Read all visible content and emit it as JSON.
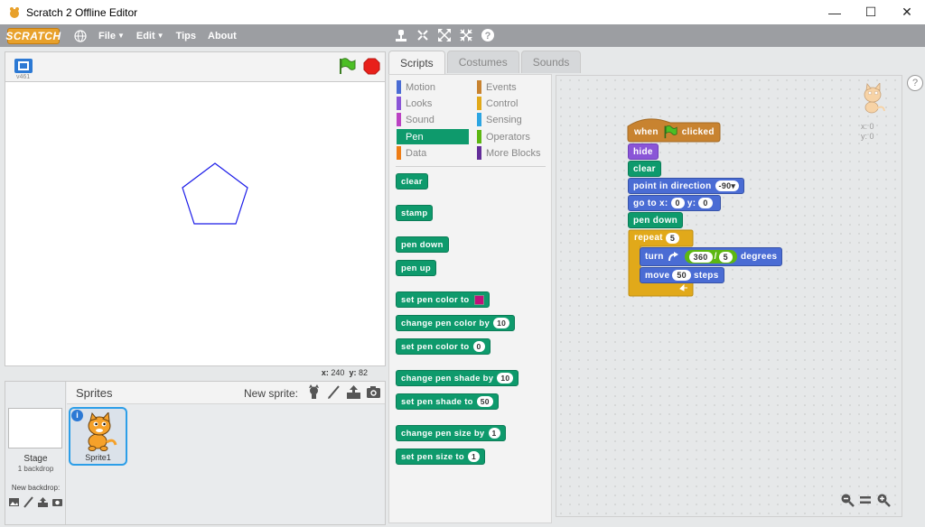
{
  "window": {
    "title": "Scratch 2 Offline Editor",
    "minimize": "—",
    "maximize": "☐",
    "close": "✕"
  },
  "menubar": {
    "logo": "SCRATCH",
    "file": "File",
    "edit": "Edit",
    "tips": "Tips",
    "about": "About"
  },
  "stage": {
    "version": "v461",
    "x_label": "x:",
    "x_value": "240",
    "y_label": "y:",
    "y_value": "82"
  },
  "sprites_pane": {
    "title": "Sprites",
    "new_sprite_label": "New sprite:",
    "stage_label": "Stage",
    "stage_backdrops": "1 backdrop",
    "new_backdrop_label": "New backdrop:",
    "sprite_name": "Sprite1",
    "info_glyph": "i"
  },
  "tabs": [
    "Scripts",
    "Costumes",
    "Sounds"
  ],
  "categories": [
    {
      "label": "Motion",
      "color": "#4a6cd4"
    },
    {
      "label": "Events",
      "color": "#c88330"
    },
    {
      "label": "Looks",
      "color": "#8a55d7"
    },
    {
      "label": "Control",
      "color": "#e1a91a"
    },
    {
      "label": "Sound",
      "color": "#bb42c3"
    },
    {
      "label": "Sensing",
      "color": "#2ca5e2"
    },
    {
      "label": "Pen",
      "color": "#0e9a6c"
    },
    {
      "label": "Operators",
      "color": "#5cb712"
    },
    {
      "label": "Data",
      "color": "#ee7d16"
    },
    {
      "label": "More Blocks",
      "color": "#632d99"
    }
  ],
  "palette_blocks": [
    {
      "label": "clear"
    },
    {
      "label": "stamp"
    },
    {
      "label": "pen down"
    },
    {
      "label": "pen up"
    },
    {
      "label": "set pen color to"
    },
    {
      "label": "change pen color by",
      "value": "10"
    },
    {
      "label": "set pen color to",
      "value": "0"
    },
    {
      "label": "change pen shade by",
      "value": "10"
    },
    {
      "label": "set pen shade to",
      "value": "50"
    },
    {
      "label": "change pen size by",
      "value": "1"
    },
    {
      "label": "set pen size to",
      "value": "1"
    }
  ],
  "script": {
    "hat_when": "when",
    "hat_clicked": "clicked",
    "hide": "hide",
    "clear": "clear",
    "point_label": "point in direction",
    "point_value": "-90▾",
    "goto_label": "go to x:",
    "goto_x": "0",
    "goto_y_label": "y:",
    "goto_y": "0",
    "pen_down": "pen down",
    "repeat_label": "repeat",
    "repeat_value": "5",
    "turn_label": "turn",
    "turn_op_a": "360",
    "turn_op_sym": "/",
    "turn_op_b": "5",
    "turn_unit": "degrees",
    "move_label": "move",
    "move_value": "50",
    "move_unit": "steps"
  },
  "sprite_corner": {
    "x_label": "x: 0",
    "y_label": "y: 0"
  },
  "colors": {
    "pen": "#0e9a6c",
    "motion": "#4a6cd4",
    "looks": "#8a55d7",
    "events": "#c88330",
    "control": "#e1a91a",
    "operators": "#5cb712",
    "pen_swatch": "#c0117a",
    "polygon": "#1a1ae8"
  }
}
